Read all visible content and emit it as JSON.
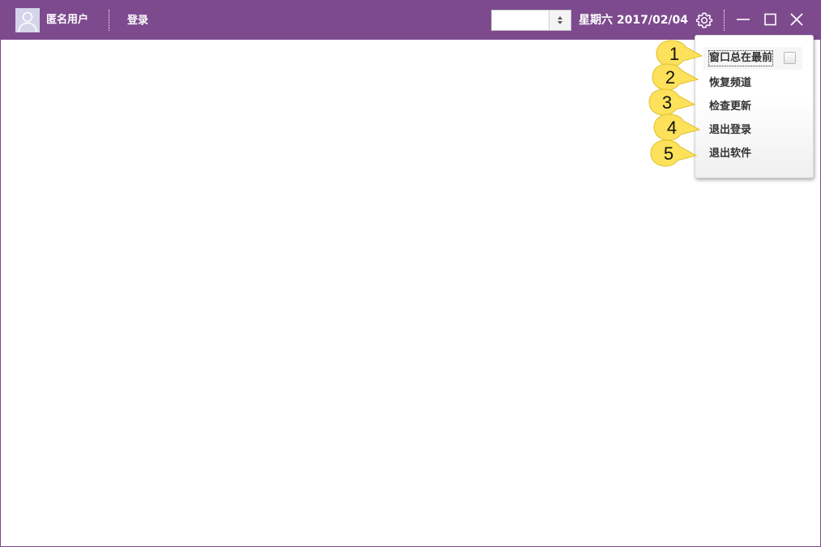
{
  "titlebar": {
    "user_name": "匿名用户",
    "login_label": "登录",
    "select_value": "",
    "date_text": "星期六 2017/02/04",
    "bg_color": "#7d4a8e"
  },
  "icons": {
    "avatar": "user-avatar-icon",
    "settings": "gear-icon",
    "minimize": "minimize-icon",
    "maximize": "maximize-icon",
    "close": "close-icon",
    "select_arrow": "up-down-arrows-icon"
  },
  "settings_menu": {
    "items": [
      {
        "label": "窗口总在最前",
        "checked": false
      },
      {
        "label": "恢复频道"
      },
      {
        "label": "检查更新"
      },
      {
        "label": "退出登录"
      },
      {
        "label": "退出软件"
      }
    ]
  },
  "callouts": [
    "1",
    "2",
    "3",
    "4",
    "5"
  ],
  "callout_color": "#fde15a"
}
